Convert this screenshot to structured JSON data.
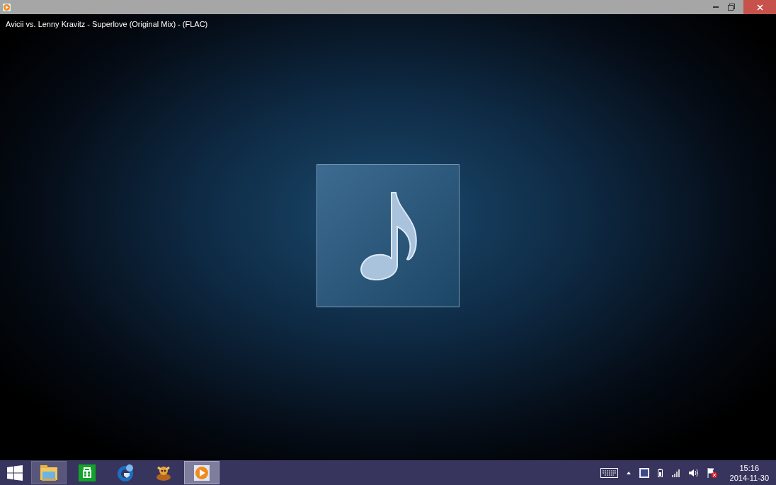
{
  "window": {
    "maximized": true
  },
  "now_playing": {
    "title": "Avicii vs. Lenny Kravitz - Superlove (Original Mix) - (FLAC)"
  },
  "taskbar": {
    "apps": [
      {
        "kind": "explorer",
        "running": true,
        "selected": false
      },
      {
        "kind": "store",
        "running": false,
        "selected": false
      },
      {
        "kind": "browser",
        "running": false,
        "selected": false
      },
      {
        "kind": "game",
        "running": false,
        "selected": false
      },
      {
        "kind": "player",
        "running": true,
        "selected": true
      }
    ],
    "clock": {
      "time": "15:16",
      "date": "2014-11-30"
    }
  }
}
